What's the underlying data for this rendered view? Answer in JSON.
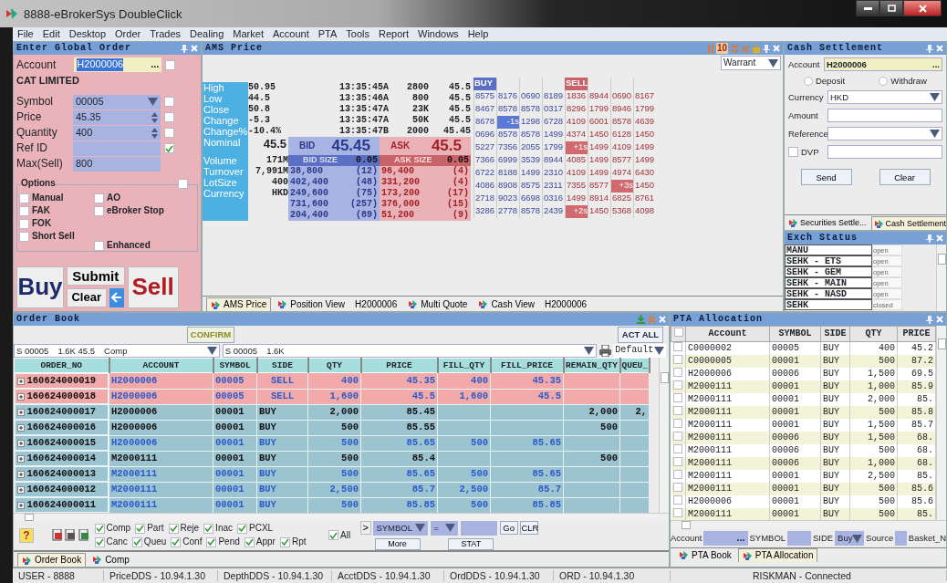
{
  "window": {
    "title": "8888-eBrokerSys DoubleClick"
  },
  "menu": [
    "File",
    "Edit",
    "Desktop",
    "Order",
    "Trades",
    "Dealing",
    "Market",
    "Account",
    "PTA",
    "Tools",
    "Report",
    "Windows",
    "Help"
  ],
  "order_entry": {
    "title": "Enter Global Order",
    "account": {
      "label": "Account",
      "value": "H2000006",
      "value_selected": true,
      "browse": "...",
      "checked": false
    },
    "account_name": "CAT LIMITED",
    "fields": [
      {
        "label": "Symbol",
        "value": "00005",
        "kind": "dropdown",
        "checked": false
      },
      {
        "label": "Price",
        "value": "45.35",
        "kind": "spinner",
        "checked": false
      },
      {
        "label": "Quantity",
        "value": "400",
        "kind": "spinner",
        "checked": false
      },
      {
        "label": "Ref ID",
        "kind": "text",
        "checked": true
      },
      {
        "label": "Max(Sell)",
        "value": "800",
        "kind": "plain"
      }
    ],
    "options_label": "Options",
    "options_checked": false,
    "options_left": [
      {
        "label": "Manual",
        "checked": false
      },
      {
        "label": "FAK",
        "checked": false
      },
      {
        "label": "FOK",
        "checked": false
      },
      {
        "label": "Short Sell",
        "checked": false
      }
    ],
    "options_right": [
      {
        "label": "AO",
        "checked": false
      },
      {
        "label": "eBroker Stop",
        "checked": false
      },
      {
        "label": "Enhanced",
        "checked": false
      }
    ],
    "buttons": {
      "buy": "Buy",
      "submit": "Submit",
      "clear": "Clear",
      "sell": "Sell"
    }
  },
  "ams": {
    "title": "AMS Price",
    "title_label": "10",
    "warrant": "Warrant",
    "stats": [
      {
        "label": "High",
        "value": "50.95",
        "time": "13:35:45A",
        "qty": "2800",
        "price": "45.5"
      },
      {
        "label": "Low",
        "value": "44.5",
        "time": "13:35:46A",
        "qty": "800",
        "price": "45.5"
      },
      {
        "label": "Close",
        "value": "50.8",
        "time": "13:35:47A",
        "qty": "23K",
        "price": "45.5"
      },
      {
        "label": "Change",
        "value": "-5.3",
        "time": "13:35:47A",
        "qty": "50K",
        "price": "45.5"
      },
      {
        "label": "Change%",
        "value": "-10.4%",
        "time": "13:35:47B",
        "qty": "2000",
        "price": "45.45"
      }
    ],
    "nominal": {
      "label": "Nominal",
      "value": "45.5"
    },
    "bid": {
      "label": "BID",
      "price": "45.45",
      "size_label": "BID SIZE",
      "spread": "0.05"
    },
    "ask": {
      "label": "ASK",
      "price": "45.5",
      "size_label": "ASK SIZE",
      "spread": "0.05"
    },
    "depth_stats": [
      {
        "label": "Volume",
        "value": "171M"
      },
      {
        "label": "Turnover",
        "value": "7,991M"
      },
      {
        "label": "LotSize",
        "value": "400"
      },
      {
        "label": "Currency",
        "value": "HKD"
      }
    ],
    "bid_depth": [
      {
        "qty": "38,800",
        "count": "(12)"
      },
      {
        "qty": "402,400",
        "count": "(48)"
      },
      {
        "qty": "249,600",
        "count": "(75)"
      },
      {
        "qty": "731,600",
        "count": "(257)"
      },
      {
        "qty": "204,400",
        "count": "(89)"
      }
    ],
    "ask_depth": [
      {
        "qty": "96,400",
        "count": "(4)"
      },
      {
        "qty": "331,200",
        "count": "(4)"
      },
      {
        "qty": "173,200",
        "count": "(17)"
      },
      {
        "qty": "376,000",
        "count": "(15)"
      },
      {
        "qty": "51,200",
        "count": "(9)"
      }
    ],
    "queue": {
      "buy_label": "BUY",
      "sell_label": "SELL",
      "rows": [
        {
          "buy": [
            "8575",
            "8176",
            "0690",
            "8189"
          ],
          "sell": [
            "1836",
            "8944",
            "0690",
            "8167"
          ]
        },
        {
          "buy": [
            "8467",
            "8578",
            "8578",
            "0317"
          ],
          "sell": [
            "8296",
            "1799",
            "8946",
            "1799"
          ]
        },
        {
          "buy": [
            "8678",
            {
              "text": "-1s",
              "kind": "time"
            },
            "1298",
            "6728"
          ],
          "sell": [
            "4109",
            "6001",
            "8578",
            "4639"
          ]
        },
        {
          "buy": [
            "0696",
            "8578",
            "8578",
            "1499"
          ],
          "sell": [
            "4374",
            "1450",
            "6128",
            "1450"
          ]
        },
        {
          "buy": [
            "5227",
            "7356",
            "2055",
            "1799"
          ],
          "sell": [
            {
              "text": "+1s",
              "kind": "time"
            },
            "1499",
            "4109",
            "1499"
          ]
        },
        {
          "buy": [
            "7366",
            "6999",
            "3539",
            "8944"
          ],
          "sell": [
            "4085",
            "1499",
            "8577",
            "1499"
          ]
        },
        {
          "buy": [
            "6722",
            "8188",
            "1499",
            "2310"
          ],
          "sell": [
            "4109",
            "1499",
            "4974",
            "6430"
          ]
        },
        {
          "buy": [
            "4086",
            "8908",
            "8575",
            "2311"
          ],
          "sell": [
            "7355",
            "8577",
            {
              "text": "+3s",
              "kind": "time"
            },
            "1450"
          ]
        },
        {
          "buy": [
            "2718",
            "9023",
            "6698",
            "0316"
          ],
          "sell": [
            "1499",
            "8914",
            "6825",
            "8761"
          ]
        },
        {
          "buy": [
            "3286",
            "2778",
            "8578",
            "2439"
          ],
          "sell": [
            {
              "text": "+2s",
              "kind": "time"
            },
            "1450",
            "5368",
            "4098"
          ]
        }
      ]
    },
    "tabs": [
      {
        "label": "AMS Price",
        "selected": true
      },
      {
        "label": "Position View",
        "detail": "H2000006",
        "selected": false
      },
      {
        "label": "Multi Quote",
        "selected": false
      },
      {
        "label": "Cash View",
        "detail": "H2000006",
        "selected": false
      }
    ]
  },
  "cash_settlement": {
    "title": "Cash Settlement",
    "account_label": "Account",
    "account": "H2000006",
    "browse": "...",
    "radios": [
      {
        "label": "Deposit",
        "selected": false
      },
      {
        "label": "Withdraw",
        "selected": false
      }
    ],
    "currency_label": "Currency",
    "currency": "HKD",
    "amount_label": "Amount",
    "reference_label": "Reference",
    "dvp_label": "DVP",
    "dvp_checked": false,
    "buttons": [
      "Send",
      "Clear"
    ],
    "tabs": [
      {
        "label": "Securities Settle...",
        "selected": false
      },
      {
        "label": "Cash Settlement",
        "selected": true
      }
    ]
  },
  "exch_status": {
    "title": "Exch Status",
    "rows": [
      {
        "market": "MANU",
        "status": "open"
      },
      {
        "market": "SEHK - ETS",
        "status": "open"
      },
      {
        "market": "SEHK - GEM",
        "status": "open"
      },
      {
        "market": "SEHK - MAIN",
        "status": "open"
      },
      {
        "market": "SEHK - NASD",
        "status": "open"
      },
      {
        "market": "SEHK",
        "status": "closed"
      }
    ]
  },
  "order_book": {
    "title": "Order Book",
    "confirm": "CONFIRM",
    "act_all": "ACT ALL",
    "filter_1": [
      "S 00005",
      "1.6K 45.5",
      "Comp"
    ],
    "filter_2": [
      "S 00005",
      "1.6K"
    ],
    "view": "Default",
    "columns": [
      "ORDER_NO",
      "ACCOUNT",
      "SYMBOL",
      "SIDE",
      "QTY",
      "PRICE",
      "FILL_QTY",
      "FILL_PRICE",
      "REMAIN_QTY",
      "QUEU_"
    ],
    "rows": [
      {
        "kind": "sell",
        "filled": true,
        "cells": [
          "160624000019",
          "H2000006",
          "00005",
          "SELL",
          "400",
          "45.35",
          "400",
          "45.35",
          null,
          null
        ]
      },
      {
        "kind": "sell",
        "filled": true,
        "cells": [
          "160624000018",
          "H2000006",
          "00005",
          "SELL",
          "1,600",
          "45.5",
          "1,600",
          "45.5",
          null,
          null
        ]
      },
      {
        "kind": "buy",
        "filled": false,
        "cells": [
          "160624000017",
          "H2000006",
          "00001",
          "BUY",
          "2,000",
          "85.45",
          null,
          null,
          "2,000",
          "2,"
        ]
      },
      {
        "kind": "buy",
        "filled": false,
        "cells": [
          "160624000016",
          "H2000006",
          "00001",
          "BUY",
          "500",
          "85.55",
          null,
          null,
          "500",
          null
        ]
      },
      {
        "kind": "buy",
        "filled": true,
        "cells": [
          "160624000015",
          "H2000006",
          "00001",
          "BUY",
          "500",
          "85.65",
          "500",
          "85.65",
          null,
          null
        ]
      },
      {
        "kind": "buy",
        "filled": false,
        "cells": [
          "160624000014",
          "M2000111",
          "00001",
          "BUY",
          "500",
          "85.4",
          null,
          null,
          "500",
          null
        ]
      },
      {
        "kind": "buy",
        "filled": true,
        "cells": [
          "160624000013",
          "M2000111",
          "00001",
          "BUY",
          "500",
          "85.65",
          "500",
          "85.65",
          null,
          null
        ]
      },
      {
        "kind": "buy",
        "filled": true,
        "cells": [
          "160624000012",
          "M2000111",
          "00001",
          "BUY",
          "2,500",
          "85.7",
          "2,500",
          "85.7",
          null,
          null
        ]
      },
      {
        "kind": "buy",
        "filled": true,
        "cells": [
          "160624000011",
          "M2000111",
          "00001",
          "BUY",
          "500",
          "85.85",
          "500",
          "85.85",
          null,
          null
        ]
      }
    ],
    "help": "?",
    "status_filters": [
      [
        {
          "label": "Comp",
          "checked": true
        },
        {
          "label": "Part",
          "checked": true
        },
        {
          "label": "Reje",
          "checked": true
        },
        {
          "label": "Inac",
          "checked": true
        },
        {
          "label": "PCXL",
          "checked": true
        }
      ],
      [
        {
          "label": "Canc",
          "checked": true
        },
        {
          "label": "Queu",
          "checked": true
        },
        {
          "label": "Conf",
          "checked": true
        },
        {
          "label": "Pend",
          "checked": true
        },
        {
          "label": "Appr",
          "checked": true
        },
        {
          "label": "Rpt",
          "checked": true
        }
      ]
    ],
    "all": {
      "label": "All",
      "checked": true
    },
    "expand": ">",
    "query": {
      "field": "SYMBOL",
      "op": "=",
      "go": "Go",
      "clear": "CLR",
      "more": "More",
      "stat": "STAT"
    },
    "tabs": [
      {
        "label": "Order Book",
        "selected": true
      },
      {
        "label": "Comp",
        "selected": false
      }
    ]
  },
  "pta": {
    "title": "PTA Allocation",
    "all_checked": false,
    "columns": [
      "Account",
      "SYMBOL",
      "SIDE",
      "QTY",
      "PRICE"
    ],
    "rows": [
      {
        "checked": false,
        "cells": [
          "C0000002",
          "00005",
          "BUY",
          "400",
          "45.2"
        ]
      },
      {
        "checked": false,
        "cells": [
          "C0000005",
          "00001",
          "BUY",
          "500",
          "87.2"
        ]
      },
      {
        "checked": false,
        "cells": [
          "H2000006",
          "00006",
          "BUY",
          "1,500",
          "69.5"
        ]
      },
      {
        "checked": false,
        "cells": [
          "M2000111",
          "00001",
          "BUY",
          "1,000",
          "85.9"
        ]
      },
      {
        "checked": false,
        "cells": [
          "M2000111",
          "00001",
          "BUY",
          "2,000",
          "85."
        ]
      },
      {
        "checked": false,
        "cells": [
          "M2000111",
          "00001",
          "BUY",
          "500",
          "85.8"
        ]
      },
      {
        "checked": false,
        "cells": [
          "M2000111",
          "00001",
          "BUY",
          "1,500",
          "85.7"
        ]
      },
      {
        "checked": false,
        "cells": [
          "M2000111",
          "00006",
          "BUY",
          "1,500",
          "68."
        ]
      },
      {
        "checked": false,
        "cells": [
          "M2000111",
          "00006",
          "BUY",
          "500",
          "68."
        ]
      },
      {
        "checked": false,
        "cells": [
          "M2000111",
          "00006",
          "BUY",
          "1,000",
          "68."
        ]
      },
      {
        "checked": false,
        "cells": [
          "M2000111",
          "00001",
          "BUY",
          "2,500",
          "85."
        ]
      },
      {
        "checked": false,
        "cells": [
          "M2000111",
          "00001",
          "BUY",
          "500",
          "85.6"
        ]
      },
      {
        "checked": false,
        "cells": [
          "H2000006",
          "00001",
          "BUY",
          "500",
          "85.6"
        ]
      },
      {
        "checked": false,
        "cells": [
          "M2000111",
          "00001",
          "BUY",
          "500",
          "85."
        ]
      }
    ],
    "filter": {
      "account_label": "Account",
      "browse": "...",
      "symbol_label": "SYMBOL",
      "side_label": "SIDE",
      "side": "Buy",
      "source_label": "Source",
      "basket_label": "Basket_N"
    },
    "tabs": [
      {
        "label": "PTA Book",
        "selected": false
      },
      {
        "label": "PTA Allocation",
        "selected": true
      }
    ]
  },
  "status_bar": [
    "USER - 8888",
    "PriceDDS - 10.94.1.30",
    "DepthDDS - 10.94.1.30",
    "AcctDDS - 10.94.1.30",
    "OrdDDS - 10.94.1.30",
    "ORD - 10.94.1.30",
    "RISKMAN - Connected"
  ]
}
